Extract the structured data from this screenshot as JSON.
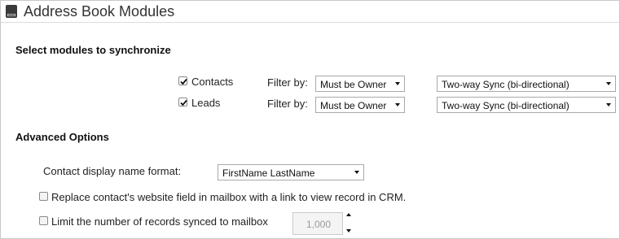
{
  "header": {
    "title": "Address Book Modules",
    "icon": "address-book-icon"
  },
  "modules_section": {
    "heading": "Select modules to synchronize",
    "rows": [
      {
        "label": "Contacts",
        "checked": true,
        "filter_label": "Filter by:",
        "filter_value": "Must be Owner",
        "sync_value": "Two-way Sync (bi-directional)"
      },
      {
        "label": "Leads",
        "checked": true,
        "filter_label": "Filter by:",
        "filter_value": "Must be Owner",
        "sync_value": "Two-way Sync (bi-directional)"
      }
    ]
  },
  "advanced": {
    "heading": "Advanced Options",
    "display_name_label": "Contact display name format:",
    "display_name_value": "FirstName LastName",
    "replace_website_label": "Replace contact's website field in mailbox with a link to view record in CRM.",
    "replace_website_checked": false,
    "limit_label": "Limit the number of records synced to mailbox",
    "limit_checked": false,
    "limit_value": "1,000"
  }
}
